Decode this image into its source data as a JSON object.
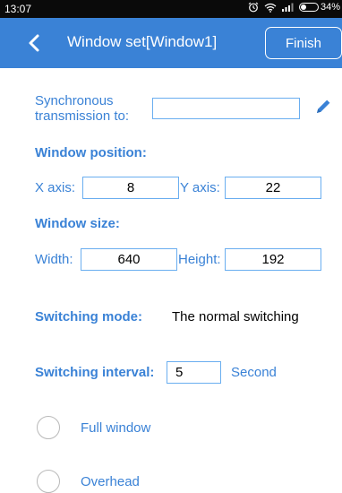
{
  "status_bar": {
    "time": "13:07",
    "battery": "34%",
    "battery_level": 0.34,
    "icons": [
      "alarm-icon",
      "wifi-icon",
      "signal-icon",
      "battery-icon"
    ]
  },
  "header": {
    "title": "Window set[Window1]",
    "finish_label": "Finish",
    "background": "#3a82d6"
  },
  "sync": {
    "label_line1": "Synchronous",
    "label_line2": "transmission to:",
    "value": "",
    "edit_icon": "pencil-icon"
  },
  "position": {
    "title": "Window position:",
    "x_label": "X axis:",
    "x_value": "8",
    "y_label": "Y axis:",
    "y_value": "22"
  },
  "size": {
    "title": "Window size:",
    "width_label": "Width:",
    "width_value": "640",
    "height_label": "Height:",
    "height_value": "192"
  },
  "switching": {
    "mode_label": "Switching mode:",
    "mode_value": "The normal switching",
    "interval_label": "Switching interval:",
    "interval_value": "5",
    "interval_unit": "Second"
  },
  "options": [
    {
      "label": "Full window",
      "selected": false
    },
    {
      "label": "Overhead",
      "selected": false
    }
  ],
  "colors": {
    "accent": "#3a82d6",
    "input_border": "#6aaef0",
    "radio_border": "#b9b9b9"
  }
}
